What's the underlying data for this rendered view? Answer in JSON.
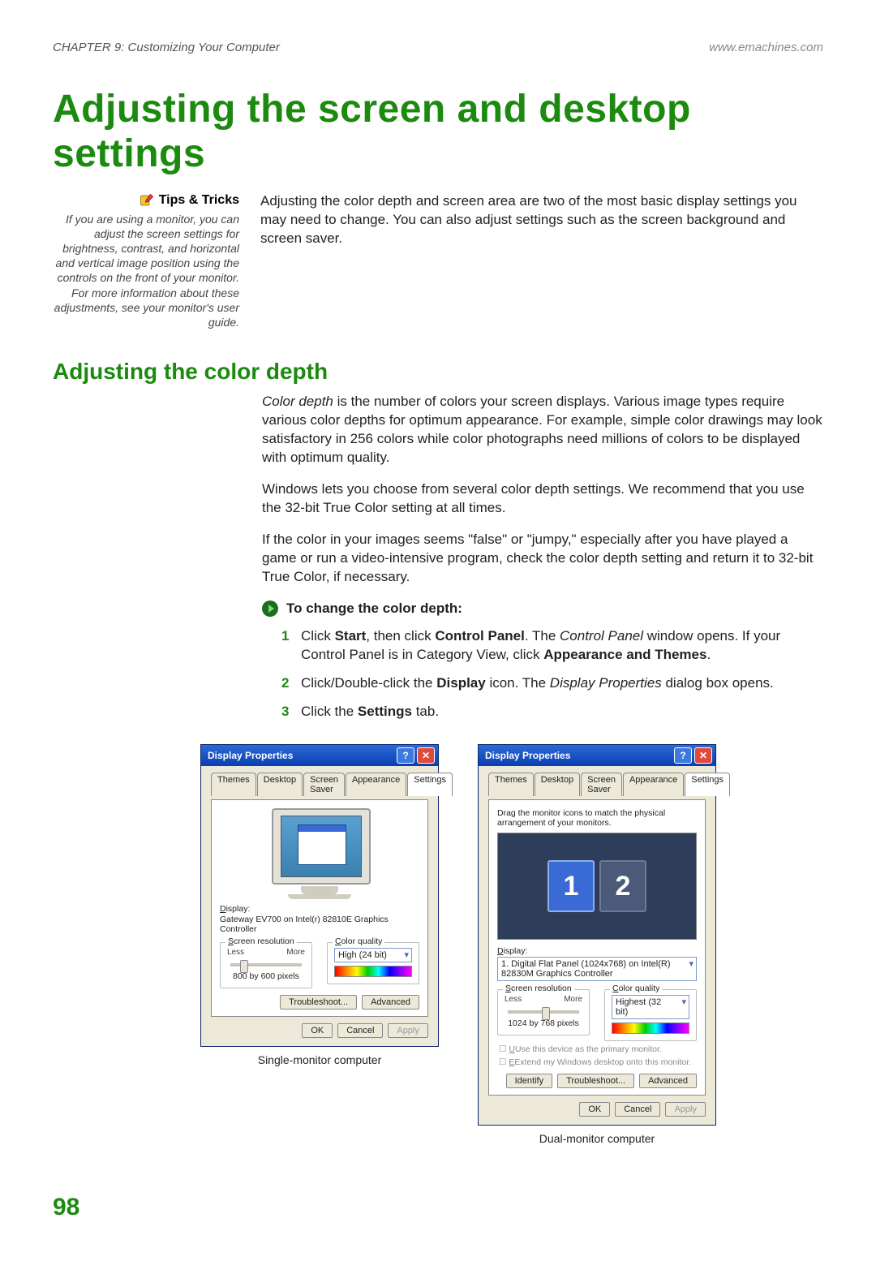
{
  "header": {
    "chapter": "CHAPTER 9: Customizing Your Computer",
    "url": "www.emachines.com"
  },
  "title": "Adjusting the screen and desktop settings",
  "tips": {
    "heading": "Tips & Tricks",
    "body": "If you are using a monitor, you can adjust the screen settings for brightness, contrast, and horizontal and vertical image position using the controls on the front of your monitor. For more information about these adjustments, see your monitor's user guide."
  },
  "intro": "Adjusting the color depth and screen area are two of the most basic display settings you may need to change. You can also adjust settings such as the screen background and screen saver.",
  "sub": "Adjusting the color depth",
  "p1_a": "Color depth",
  "p1_b": " is the number of colors your screen displays. Various image types require various color depths for optimum appearance. For example, simple color drawings may look satisfactory in 256 colors while color photographs need millions of colors to be displayed with optimum quality.",
  "p2": "Windows lets you choose from several color depth settings. We recommend that you use the 32-bit True Color setting at all times.",
  "p3": "If the color in your images seems \"false\" or \"jumpy,\" especially after you have played a game or run a video-intensive program, check the color depth setting and return it to 32-bit True Color, if necessary.",
  "proc": "To change the color depth:",
  "s1": {
    "a": "Click ",
    "b": "Start",
    "c": ", then click ",
    "d": "Control Panel",
    "e": ". The ",
    "f": "Control Panel",
    "g": " window opens. If your Control Panel is in Category View, click ",
    "h": "Appearance and Themes",
    "i": "."
  },
  "s2": {
    "a": "Click/Double-click the ",
    "b": "Display",
    "c": " icon. The ",
    "d": "Display Properties",
    "e": " dialog box opens."
  },
  "s3": {
    "a": "Click the ",
    "b": "Settings",
    "c": " tab."
  },
  "dlg": {
    "title": "Display Properties",
    "tabs": [
      "Themes",
      "Desktop",
      "Screen Saver",
      "Appearance",
      "Settings"
    ],
    "hint": "Drag the monitor icons to match the physical arrangement of your monitors.",
    "displayLbl": "Display:",
    "display1": "Gateway EV700 on Intel(r) 82810E Graphics Controller",
    "display2": "1. Digital Flat Panel (1024x768) on Intel(R) 82830M Graphics Controller",
    "res": "Screen resolution",
    "cq": "Color quality",
    "less": "Less",
    "more": "More",
    "res1": "800 by 600 pixels",
    "res2": "1024 by 768 pixels",
    "cq1": "High (24 bit)",
    "cq2": "Highest (32 bit)",
    "cb1": "Use this device as the primary monitor.",
    "cb2": "Extend my Windows desktop onto this monitor.",
    "identify": "Identify",
    "trouble": "Troubleshoot...",
    "adv": "Advanced",
    "ok": "OK",
    "cancel": "Cancel",
    "apply": "Apply"
  },
  "cap1": "Single-monitor computer",
  "cap2": "Dual-monitor computer",
  "page": "98"
}
